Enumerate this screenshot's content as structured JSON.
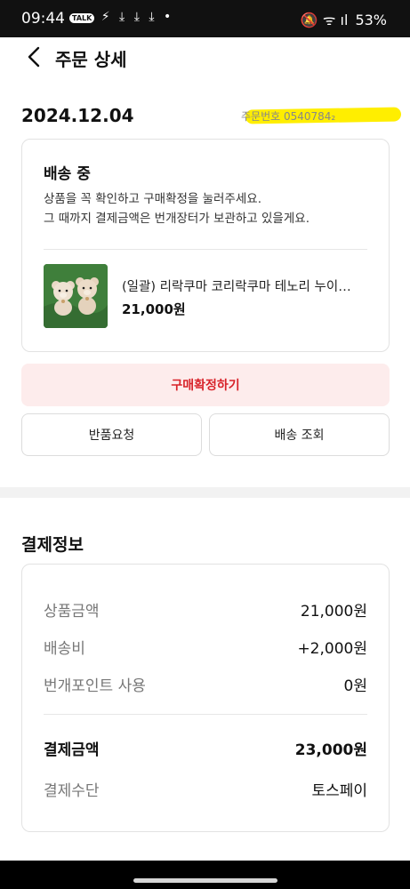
{
  "status_bar": {
    "time": "09:44",
    "talk_badge": "TALK",
    "left_icons": "⚡ ⤓ ⤓ ⤓ •",
    "right_icons": "🔕 ᯤ ıl",
    "battery": "53%"
  },
  "header": {
    "title": "주문 상세",
    "back_icon": "chevron-left-icon"
  },
  "order": {
    "date": "2024.12.04",
    "number_redacted": "주문번호 0540784₂"
  },
  "status_card": {
    "title": "배송 중",
    "desc_line1": "상품을 꼭 확인하고 구매확정을 눌러주세요.",
    "desc_line2": "그 때까지 결제금액은 번개장터가 보관하고 있을게요.",
    "product_name": "(일괄) 리락쿠마 코리락쿠마 테노리 누이…",
    "product_price": "21,000원"
  },
  "actions": {
    "confirm_label": "구매확정하기",
    "return_label": "반품요청",
    "tracking_label": "배송 조회"
  },
  "payment": {
    "section_title": "결제정보",
    "rows": [
      {
        "label": "상품금액",
        "value": "21,000원"
      },
      {
        "label": "배송비",
        "value": "+2,000원"
      },
      {
        "label": "번개포인트 사용",
        "value": "0원"
      }
    ],
    "total_label": "결제금액",
    "total_value": "23,000원",
    "method_label": "결제수단",
    "method_value": "토스페이"
  },
  "colors": {
    "accent": "#d8232a",
    "confirm_bg": "#fdecec",
    "highlight": "#ffee00"
  }
}
